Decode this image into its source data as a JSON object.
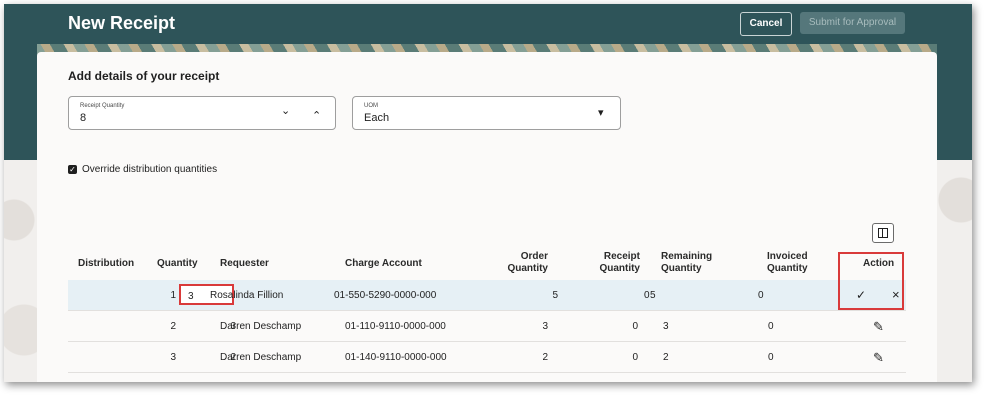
{
  "header": {
    "title": "New Receipt",
    "cancel_label": "Cancel",
    "submit_label": "Submit for Approval"
  },
  "form": {
    "section_title": "Add details of your receipt",
    "receipt_quantity": {
      "label": "Receipt Quantity",
      "value": "8"
    },
    "uom": {
      "label": "UOM",
      "value": "Each"
    },
    "override_label": "Override distribution quantities",
    "override_checked": true
  },
  "table": {
    "headers": {
      "distribution": "Distribution",
      "quantity": "Quantity",
      "requester": "Requester",
      "charge_account": "Charge Account",
      "order_qty_1": "Order",
      "order_qty_2": "Quantity",
      "receipt_qty_1": "Receipt",
      "receipt_qty_2": "Quantity",
      "remaining_qty_1": "Remaining",
      "remaining_qty_2": "Quantity",
      "invoiced_qty_1": "Invoiced",
      "invoiced_qty_2": "Quantity",
      "action": "Action"
    },
    "rows": [
      {
        "distribution": "1",
        "quantity": "3",
        "requester": "Rosalinda Fillion",
        "charge_account": "01-550-5290-0000-000",
        "order_quantity": "5",
        "receipt_quantity": "0",
        "remaining_quantity": "5",
        "invoiced_quantity": "0"
      },
      {
        "distribution": "2",
        "quantity": "3",
        "requester": "Darren Deschamp",
        "charge_account": "01-110-9110-0000-000",
        "order_quantity": "3",
        "receipt_quantity": "0",
        "remaining_quantity": "3",
        "invoiced_quantity": "0"
      },
      {
        "distribution": "3",
        "quantity": "2",
        "requester": "Darren Deschamp",
        "charge_account": "01-140-9110-0000-000",
        "order_quantity": "2",
        "receipt_quantity": "0",
        "remaining_quantity": "2",
        "invoiced_quantity": "0"
      }
    ]
  },
  "icons": {
    "checkmark": "✓",
    "close": "×",
    "chevron_down": "⌄",
    "chevron_up": "⌃",
    "caret_down": "▾",
    "checkbox_check": "✓",
    "edit": "✎"
  },
  "colors": {
    "header_bg": "#2e5459",
    "highlight": "#d93a3a",
    "selected_row": "#e6f0f5"
  }
}
